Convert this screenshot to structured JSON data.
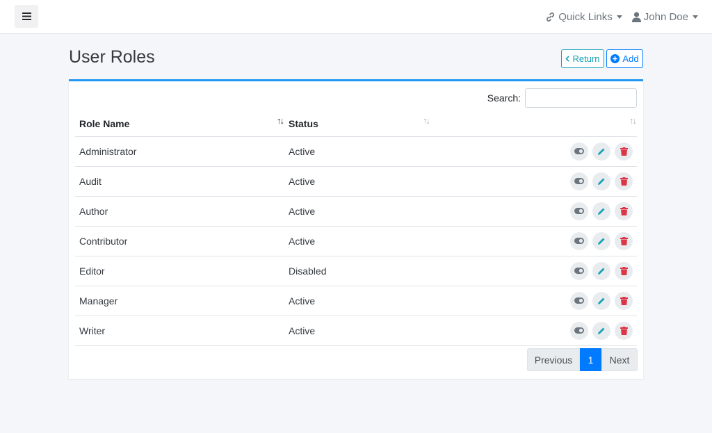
{
  "navbar": {
    "quick_links": "Quick Links",
    "user_name": "John Doe"
  },
  "page": {
    "title": "User Roles",
    "return_label": "Return",
    "add_label": "Add"
  },
  "table": {
    "search_label": "Search:",
    "search_value": "",
    "headers": {
      "name": "Role Name",
      "status": "Status"
    },
    "rows": [
      {
        "name": "Administrator",
        "status": "Active"
      },
      {
        "name": "Audit",
        "status": "Active"
      },
      {
        "name": "Author",
        "status": "Active"
      },
      {
        "name": "Contributor",
        "status": "Active"
      },
      {
        "name": "Editor",
        "status": "Disabled"
      },
      {
        "name": "Manager",
        "status": "Active"
      },
      {
        "name": "Writer",
        "status": "Active"
      }
    ]
  },
  "pagination": {
    "previous": "Previous",
    "current": "1",
    "next": "Next"
  },
  "colors": {
    "primary": "#007bff",
    "info": "#17a2b8",
    "danger": "#dc3545",
    "card_accent": "#2196f3"
  },
  "icons": {
    "menu": "bars-icon",
    "quick_links": "link-icon",
    "user": "user-icon",
    "return": "chevron-left-icon",
    "add": "plus-circle-icon",
    "row_actions": [
      "toggle-icon",
      "pencil-icon",
      "trash-icon"
    ]
  }
}
